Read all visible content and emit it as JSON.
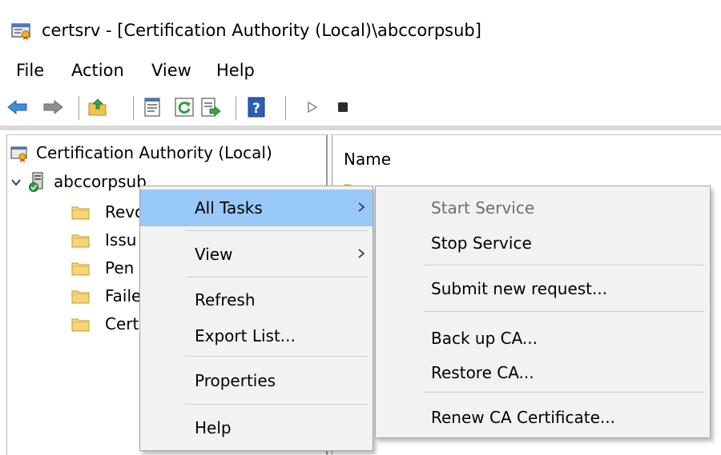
{
  "window": {
    "title": "certsrv - [Certification Authority (Local)\\abccorpsub]"
  },
  "menu_bar": [
    "File",
    "Action",
    "View",
    "Help"
  ],
  "toolbar": {
    "icons": [
      "back-arrow-icon",
      "forward-arrow-icon",
      "up-folder-icon",
      "properties-icon",
      "refresh-icon",
      "export-list-icon",
      "help-icon",
      "start-service-icon",
      "stop-service-icon"
    ]
  },
  "tree": {
    "root": "Certification Authority (Local)",
    "ca": "abccorpsub",
    "children": [
      "Revoked Certificates",
      "Issued Certificates",
      "Pending Requests",
      "Failed Requests",
      "Certificate Templates"
    ],
    "children_visible": [
      "Revo",
      "Issu",
      "Pen",
      "Faile",
      "Cert"
    ]
  },
  "list": {
    "column_name": "Name"
  },
  "context_menu": {
    "items": [
      {
        "label": "All Tasks",
        "submenu": true,
        "highlighted": true
      },
      {
        "label": "View",
        "submenu": true
      },
      {
        "label": "Refresh"
      },
      {
        "label": "Export List..."
      },
      {
        "label": "Properties"
      },
      {
        "label": "Help"
      }
    ]
  },
  "all_tasks_submenu": {
    "items": [
      {
        "label": "Start Service",
        "enabled": false
      },
      {
        "label": "Stop Service",
        "enabled": true
      },
      {
        "label": "Submit new request...",
        "enabled": true
      },
      {
        "label": "Back up CA...",
        "enabled": true
      },
      {
        "label": "Restore CA...",
        "enabled": true
      },
      {
        "label": "Renew CA Certificate...",
        "enabled": true
      }
    ]
  },
  "colors": {
    "highlight": "#99c9f6",
    "menu_bg": "#f2f2f2",
    "disabled_text": "#6d6d6d"
  }
}
